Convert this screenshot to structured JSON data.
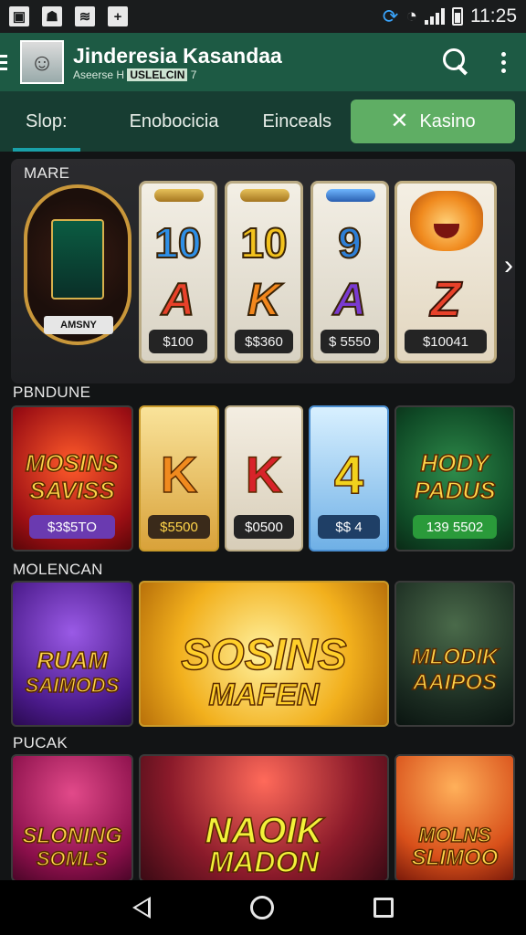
{
  "statusbar": {
    "left_icons": [
      "gallery-icon",
      "android-icon",
      "cloud-icon",
      "plus-icon"
    ],
    "time": "11:25"
  },
  "appbar": {
    "title": "Jinderesia Kasandaa",
    "subtitle_prefix": "Aseerse H",
    "subtitle_badge": "USLELCIN",
    "subtitle_suffix": "7"
  },
  "tabs": [
    {
      "label": "Slop:",
      "active": true
    },
    {
      "label": "Enobocicia",
      "active": false
    },
    {
      "label": "Einceals",
      "active": false
    }
  ],
  "pill_tab": {
    "label": "Kasino",
    "icon": "close-icon"
  },
  "sections": {
    "featured": "MARE",
    "popular": "PBNDUNE",
    "more": "MOLENCAN",
    "last": "PUCAK"
  },
  "featured": {
    "wheel_label": "AMSNY",
    "reels": [
      {
        "num": "10",
        "letter": "A",
        "price": "$100",
        "num_color": "#2e8fe6",
        "let_color": "#e8412a"
      },
      {
        "num": "10",
        "letter": "K",
        "price": "$$360",
        "num_color": "#f2c21d",
        "let_color": "#f2871d"
      },
      {
        "num": "9",
        "letter": "A",
        "price": "$ 5550",
        "num_color": "#2e7fd6",
        "let_color": "#7a3ad0"
      }
    ],
    "tiger_letter": "Z",
    "tiger_price": "$10041"
  },
  "row2": [
    {
      "title_top": "MOSINS",
      "title_bottom": "SAVISS",
      "price": "$3$5TO"
    },
    {
      "letter": "K",
      "price": "$5500"
    },
    {
      "letter": "K",
      "price": "$0500"
    },
    {
      "letter": "4",
      "price": "$$ 4"
    },
    {
      "title_top": "HODY",
      "title_bottom": "PADUS",
      "price": "139 5502"
    }
  ],
  "row3": [
    {
      "title_top": "RUAM",
      "title_bottom": "SAIMODS"
    },
    {
      "title_top": "SOSINS",
      "title_bottom": "MAFEN"
    },
    {
      "title_top": "MLODIK",
      "title_bottom": "AAIPOS"
    }
  ],
  "row4": [
    {
      "title_top": "SLONING",
      "title_bottom": "SOMLS"
    },
    {
      "title_top": "NAOIK",
      "title_bottom": "MADON"
    },
    {
      "title_top": "MOLNS",
      "title_bottom": "SLIMOO"
    }
  ]
}
